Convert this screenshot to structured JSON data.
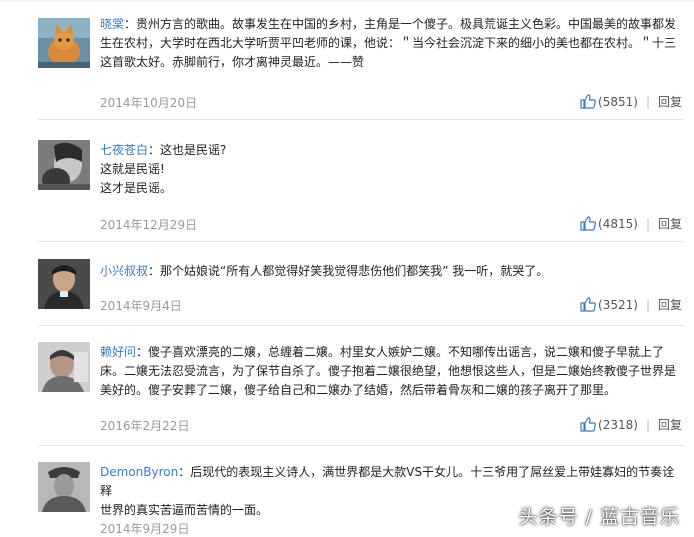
{
  "comments": [
    {
      "user": "晓棠",
      "lines": [
        "贵州方言的歌曲。故事发生在中国的乡村，主角是一个傻子。极具荒诞主义色彩。中国最美的故事都发",
        "生在农村，大学时在西北大学听贾平凹老师的课，他说：＂当今社会沉淀下来的细小的美也都在农村。＂十三",
        "这首歌太好。赤脚前行，你才离神灵最近。——赞"
      ],
      "date": "2014年10月20日",
      "likes": "(5851)",
      "reply": "回复"
    },
    {
      "user": "七夜苍白",
      "lines": [
        "这也是民谣?",
        "这就是民谣!",
        "这才是民谣。"
      ],
      "date": "2014年12月29日",
      "likes": "(4815)",
      "reply": "回复"
    },
    {
      "user": "小兴叔叔",
      "lines": [
        "那个姑娘说“所有人都觉得好笑我觉得悲伤他们都笑我” 我一听，就哭了。"
      ],
      "date": "2014年9月4日",
      "likes": "(3521)",
      "reply": "回复"
    },
    {
      "user": "赖好问",
      "lines": [
        "傻子喜欢漂亮的二嬢，总缠着二嬢。村里女人嫉妒二嬢。不知哪传出谣言，说二嬢和傻子早就上了",
        "床。二嬢无法忍受流言，为了保节自杀了。傻子抱着二嬢很绝望，他想恨这些人，但是二嬢始终教傻子世界是",
        "美好的。傻子安葬了二嬢，傻子给自己和二嬢办了结婚，然后带着骨灰和二嬢的孩子离开了那里。"
      ],
      "date": "2016年2月22日",
      "likes": "(2318)",
      "reply": "回复"
    },
    {
      "user": "DemonByron",
      "lines": [
        "后现代的表现主义诗人，满世界都是大款VS干女儿。十三爷用了屌丝爱上带娃寡妇的节奏诠释",
        "世界的真实苦逼而苦情的一面。"
      ],
      "date": "2014年9月29日",
      "likes": "",
      "reply": ""
    }
  ],
  "watermark": "头条号 / 蓝古音乐",
  "colors": {
    "username": "#3b7bbf",
    "date": "#9a9a9a",
    "like_icon": "#3b7bbf"
  },
  "icons": {
    "like": "thumbs-up-icon"
  }
}
